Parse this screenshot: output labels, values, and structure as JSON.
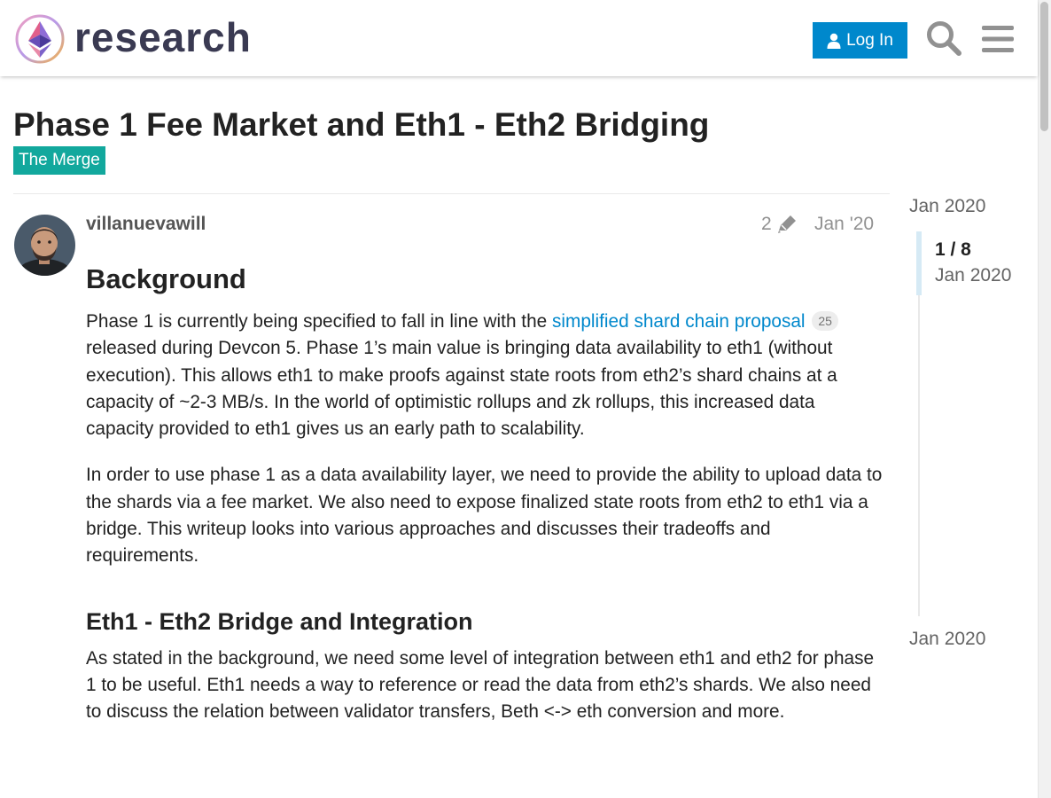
{
  "header": {
    "logo_text": "research",
    "login_label": "Log In"
  },
  "topic": {
    "title": "Phase 1 Fee Market and Eth1 - Eth2 Bridging",
    "category": "The Merge",
    "category_color": "#12a89d"
  },
  "post": {
    "username": "villanuevawill",
    "edit_count": "2",
    "date": "Jan '20",
    "heading_background": "Background",
    "p1_before_link": "Phase 1 is currently being specified to fall in line with the ",
    "p1_link": "simplified shard chain proposal",
    "p1_link_clicks": "25",
    "p1_after_link": " released during Devcon 5. Phase 1’s main value is bringing data availability to eth1 (without execution). This allows eth1 to make proofs against state roots from eth2’s shard chains at a capacity of ~2-3 MB/s. In the world of optimistic rollups and zk rollups, this increased data capacity provided to eth1 gives us an early path to scalability.",
    "p2": "In order to use phase 1 as a data availability layer, we need to provide the ability to upload data to the shards via a fee market. We also need to expose finalized state roots from eth2 to eth1 via a bridge. This writeup looks into various approaches and discusses their tradeoffs and requirements.",
    "heading_bridge": "Eth1 - Eth2 Bridge and Integration",
    "p3": "As stated in the background, we need some level of integration between eth1 and eth2 for phase 1 to be useful. Eth1 needs a way to reference or read the data from eth2’s shards. We also need to discuss the relation between validator transfers, Beth <-> eth conversion and more."
  },
  "timeline": {
    "start_date": "Jan 2020",
    "position": "1 / 8",
    "position_date": "Jan 2020",
    "end_date": "Jan 2020"
  },
  "icons": {
    "login": "user-icon",
    "search": "search-icon",
    "menu": "hamburger-menu-icon",
    "edit": "pencil-icon"
  },
  "colors": {
    "accent": "#0088cc"
  }
}
